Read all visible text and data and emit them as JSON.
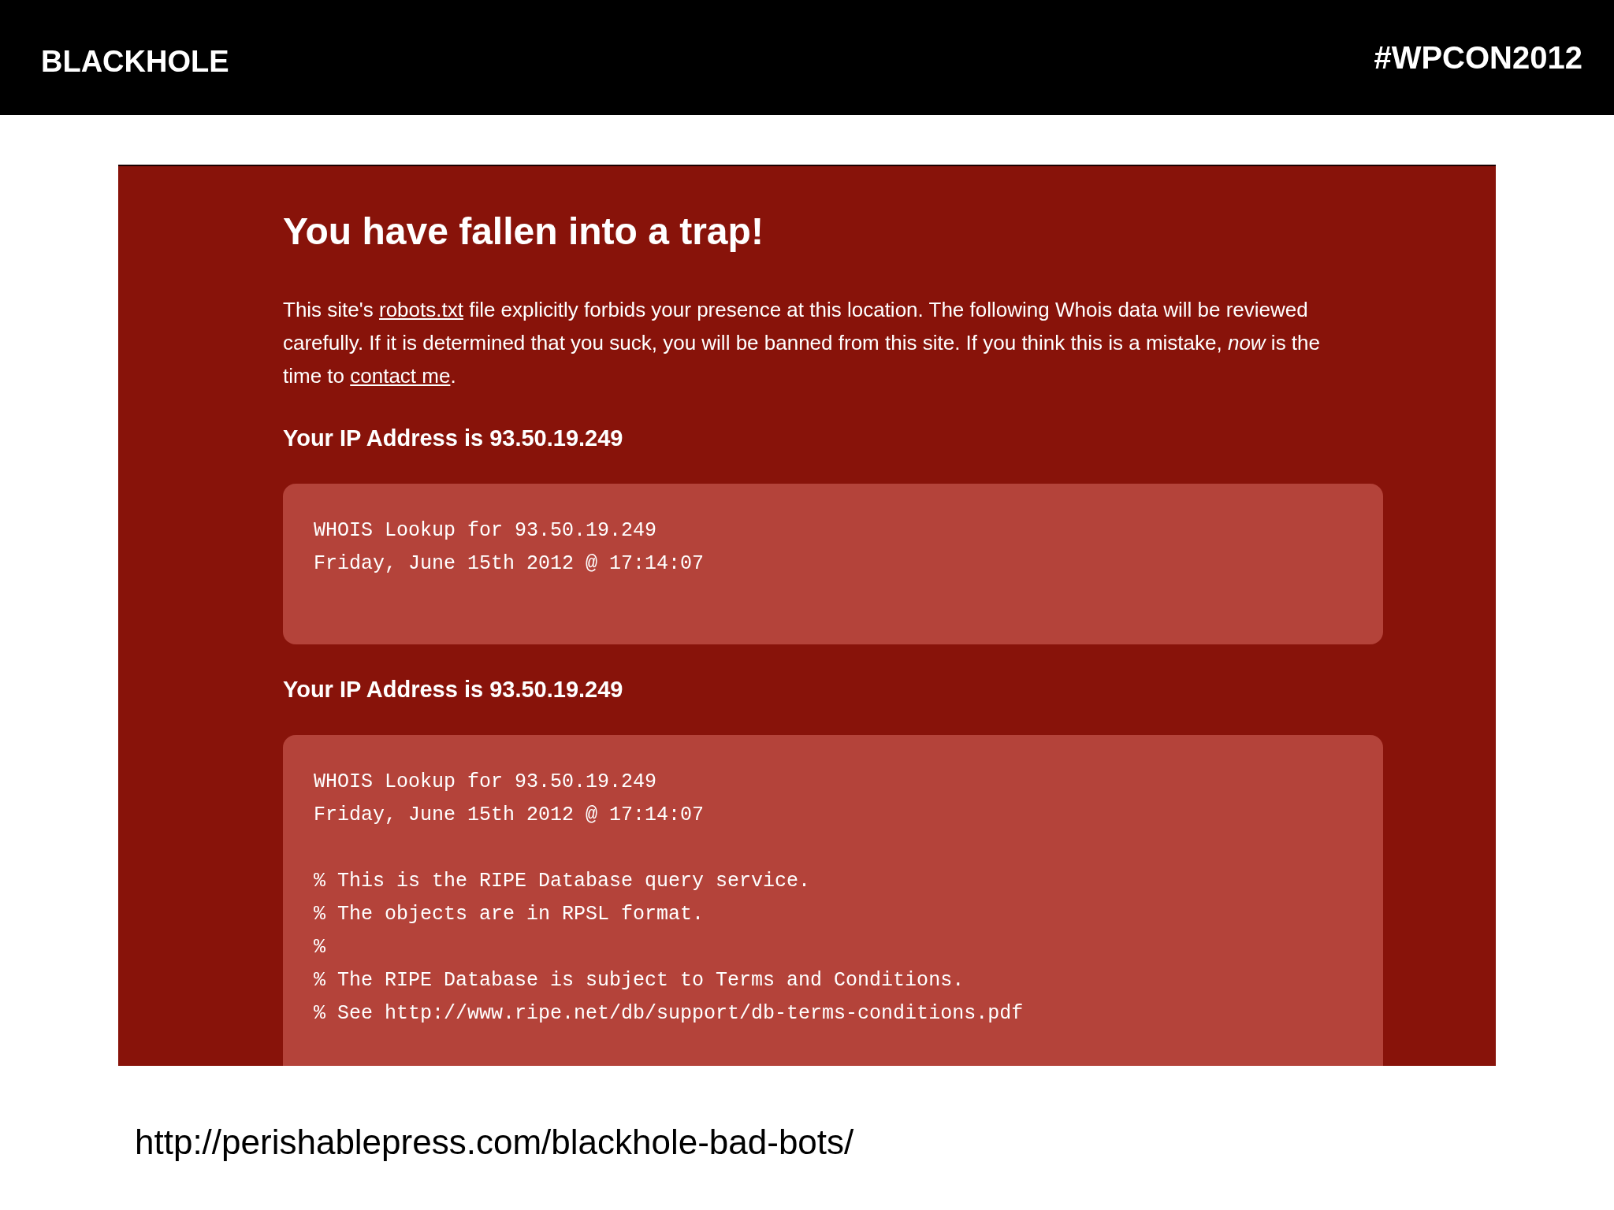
{
  "header": {
    "title": "BLACKHOLE",
    "hashtag": "#WPCON2012"
  },
  "page": {
    "heading": "You have fallen into a trap!",
    "intro": [
      {
        "kind": "plain",
        "text": "This site's "
      },
      {
        "kind": "link",
        "text": "robots.txt"
      },
      {
        "kind": "plain",
        "text": " file explicitly forbids your presence at this location. The following Whois data will be reviewed carefully. If it is determined that you suck, you will be banned from this site. If you think this is a mistake, *now* is the time to "
      },
      {
        "kind": "link",
        "text": "contact me"
      },
      {
        "kind": "plain",
        "text": "."
      }
    ],
    "sections": [
      {
        "heading": "Your IP Address is 93.50.19.249",
        "blocks": [
          [
            "WHOIS Lookup for 93.50.19.249",
            "Friday, June 15th 2012 @ 17:14:07"
          ]
        ]
      },
      {
        "heading": "Your IP Address is 93.50.19.249",
        "blocks": [
          [
            "WHOIS Lookup for 93.50.19.249",
            "Friday, June 15th 2012 @ 17:14:07"
          ],
          [
            "% This is the RIPE Database query service.",
            "% The objects are in RPSL format.",
            "%",
            "% The RIPE Database is subject to Terms and Conditions.",
            "% See http://www.ripe.net/db/support/db-terms-conditions.pdf"
          ]
        ]
      }
    ]
  },
  "footer": {
    "source_url": "http://perishablepress.com/blackhole-bad-bots/"
  }
}
